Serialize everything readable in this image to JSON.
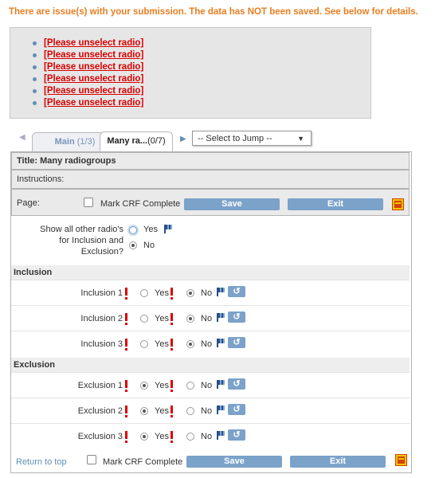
{
  "error": {
    "banner": "There are issue(s) with your submission. The data has NOT been saved. See below for details.",
    "items": [
      "[Please unselect radio]",
      "[Please unselect radio]",
      "[Please unselect radio]",
      "[Please unselect radio]",
      "[Please unselect radio]",
      "[Please unselect radio]"
    ]
  },
  "tabs": {
    "prev_icon": "◀",
    "main_label": "Main",
    "main_count": "(1/3)",
    "active_label": "Many ra...",
    "active_count": "(0/7)",
    "next_icon": "▶",
    "jump_placeholder": "-- Select to Jump --",
    "jump_arrow": "▼"
  },
  "form": {
    "title": "Title: Many radiogroups",
    "instructions": "Instructions:",
    "page_label": "Page:",
    "mark_complete": "Mark CRF Complete",
    "save": "Save",
    "exit": "Exit",
    "show_question": "Show all other radio's for Inclusion and Exclusion?",
    "show_q_line1": "Show all other radio's",
    "show_q_line2": "for Inclusion and",
    "show_q_line3": "Exclusion?",
    "yes": "Yes",
    "no": "No",
    "reset_icon": "↺",
    "sections": [
      {
        "title": "Inclusion",
        "items": [
          {
            "label": "Inclusion 1",
            "selected": "No"
          },
          {
            "label": "Inclusion 2",
            "selected": "No"
          },
          {
            "label": "Inclusion 3",
            "selected": "No"
          }
        ]
      },
      {
        "title": "Exclusion",
        "items": [
          {
            "label": "Exclusion 1",
            "selected": "Yes"
          },
          {
            "label": "Exclusion 2",
            "selected": "Yes"
          },
          {
            "label": "Exclusion 3",
            "selected": "Yes"
          }
        ]
      }
    ],
    "return_to_top": "Return to top"
  },
  "colors": {
    "error_orange": "#e87e21",
    "error_red": "#d80000",
    "button_blue": "#7ba2c9"
  },
  "icons": [
    "flag-icon",
    "reset-icon",
    "pdf-icon",
    "exclamation-icon"
  ]
}
